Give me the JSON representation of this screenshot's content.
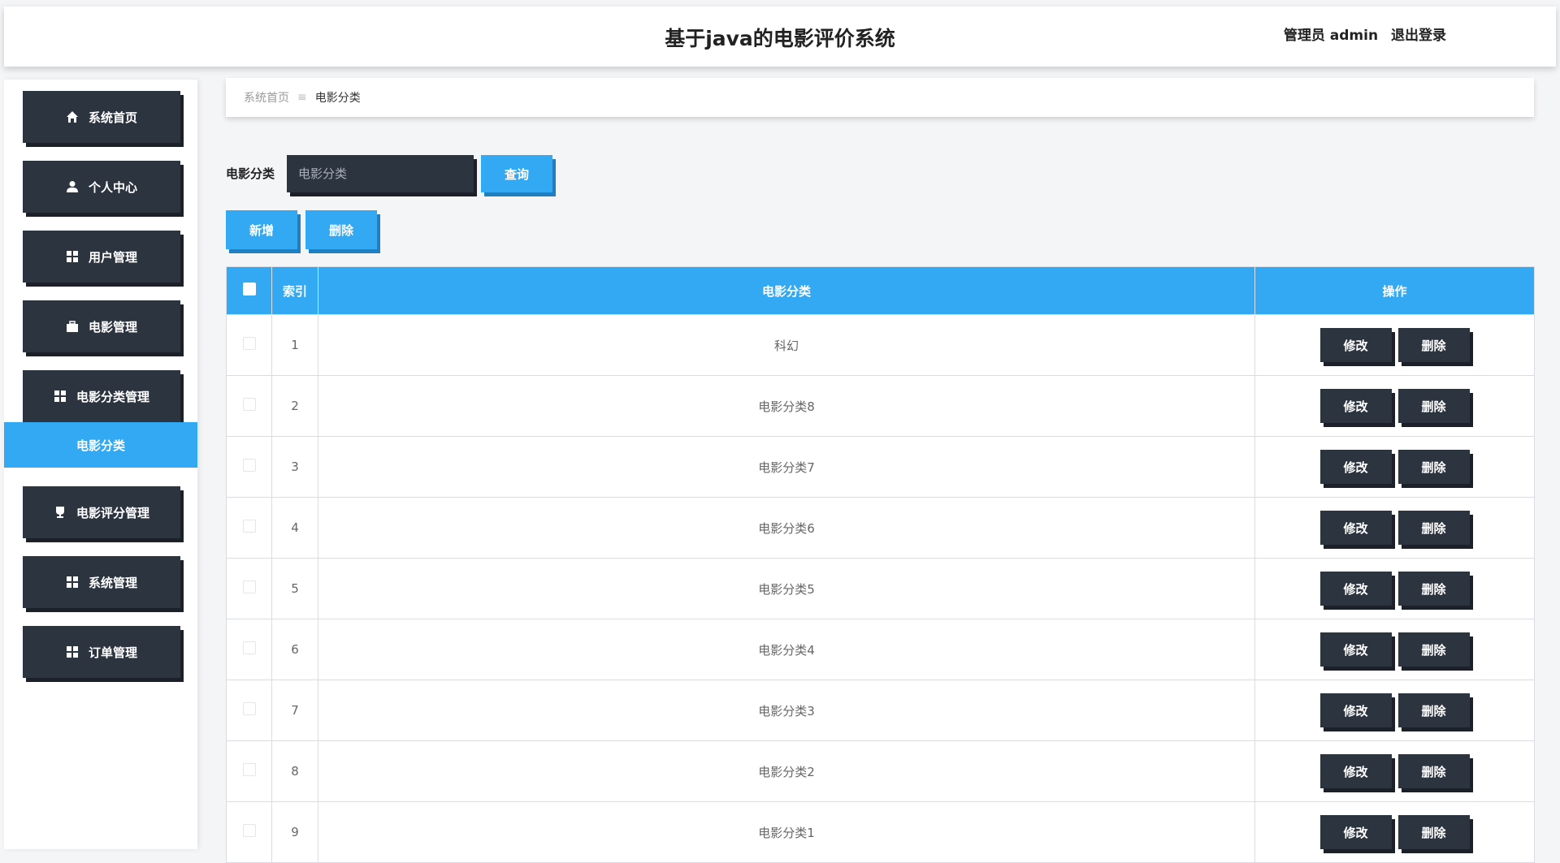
{
  "header": {
    "title": "基于java的电影评价系统",
    "user_label": "管理员 admin",
    "logout_label": "退出登录"
  },
  "sidebar": {
    "items": [
      {
        "label": "系统首页",
        "icon": "home-icon"
      },
      {
        "label": "个人中心",
        "icon": "user-icon"
      },
      {
        "label": "用户管理",
        "icon": "grid-icon"
      },
      {
        "label": "电影管理",
        "icon": "briefcase-icon"
      },
      {
        "label": "电影分类管理",
        "icon": "grid-icon"
      },
      {
        "label": "电影评分管理",
        "icon": "trophy-icon"
      },
      {
        "label": "系统管理",
        "icon": "grid-icon"
      },
      {
        "label": "订单管理",
        "icon": "grid-icon"
      }
    ],
    "active_sub": "电影分类"
  },
  "breadcrumb": {
    "home": "系统首页",
    "separator": "≡",
    "current": "电影分类"
  },
  "search": {
    "label": "电影分类",
    "placeholder": "电影分类",
    "query_label": "查询"
  },
  "actions": {
    "add_label": "新增",
    "delete_label": "删除"
  },
  "table": {
    "headers": {
      "index": "索引",
      "category": "电影分类",
      "operation": "操作"
    },
    "edit_label": "修改",
    "delete_label": "删除",
    "rows": [
      {
        "index": "1",
        "category": "科幻"
      },
      {
        "index": "2",
        "category": "电影分类8"
      },
      {
        "index": "3",
        "category": "电影分类7"
      },
      {
        "index": "4",
        "category": "电影分类6"
      },
      {
        "index": "5",
        "category": "电影分类5"
      },
      {
        "index": "6",
        "category": "电影分类4"
      },
      {
        "index": "7",
        "category": "电影分类3"
      },
      {
        "index": "8",
        "category": "电影分类2"
      },
      {
        "index": "9",
        "category": "电影分类1"
      }
    ]
  },
  "colors": {
    "primary": "#33a8f3",
    "dark": "#2c3440"
  }
}
